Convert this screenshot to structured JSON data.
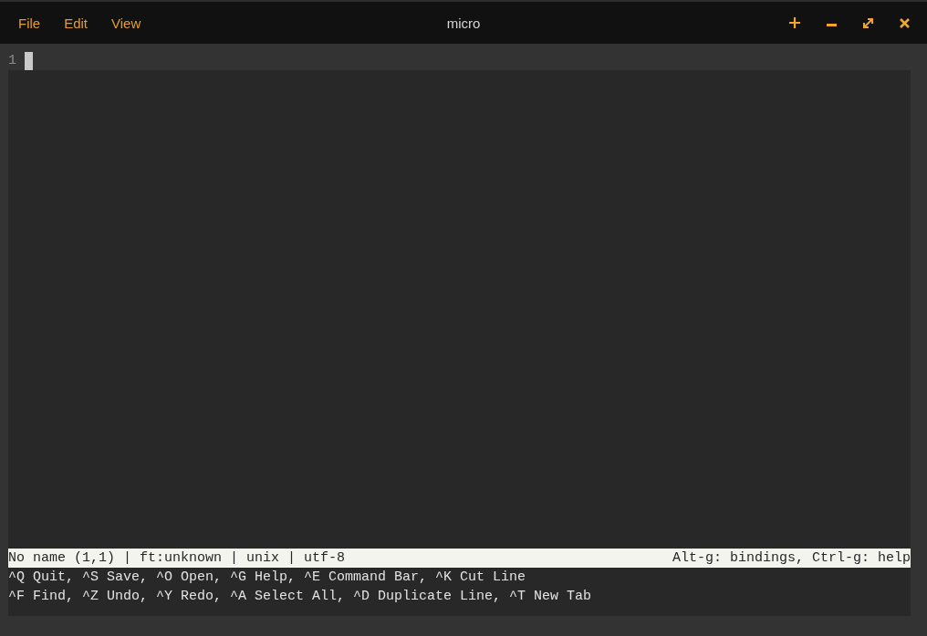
{
  "window": {
    "menu": [
      "File",
      "Edit",
      "View"
    ],
    "title": "micro"
  },
  "editor": {
    "lines": [
      {
        "number": "1",
        "current": true
      }
    ]
  },
  "status_bar": {
    "left": "No name (1,1) | ft:unknown | unix | utf-8",
    "right": "Alt-g: bindings, Ctrl-g: help"
  },
  "help_lines": [
    "^Q Quit, ^S Save, ^O Open, ^G Help, ^E Command Bar, ^K Cut Line",
    "^F Find, ^Z Undo, ^Y Redo, ^A Select All, ^D Duplicate Line, ^T New Tab"
  ]
}
